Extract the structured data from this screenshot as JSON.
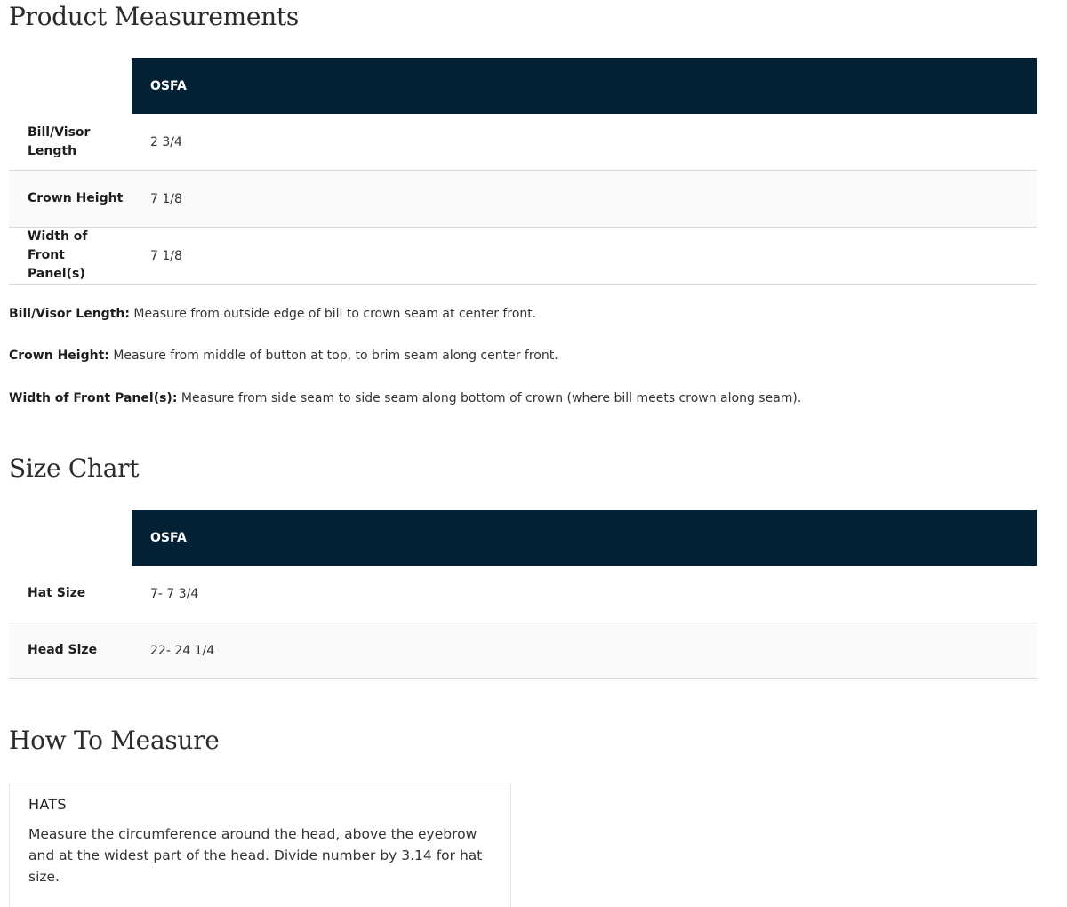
{
  "product_measurements": {
    "title": "Product Measurements",
    "column_header": "OSFA",
    "rows": [
      {
        "label": "Bill/Visor Length",
        "value": "2 3/4"
      },
      {
        "label": "Crown Height",
        "value": "7 1/8"
      },
      {
        "label": "Width of Front Panel(s)",
        "value": "7 1/8"
      }
    ],
    "notes": [
      {
        "term": "Bill/Visor Length:",
        "text": " Measure from outside edge of bill to crown seam at center front."
      },
      {
        "term": "Crown Height:",
        "text": " Measure from middle of button at top, to brim seam along center front."
      },
      {
        "term": "Width of Front Panel(s):",
        "text": " Measure from side seam to side seam along bottom of crown (where bill meets crown along seam)."
      }
    ]
  },
  "size_chart": {
    "title": "Size Chart",
    "column_header": "OSFA",
    "rows": [
      {
        "label": "Hat Size",
        "value": "7- 7 3/4"
      },
      {
        "label": "Head Size",
        "value": "22- 24 1/4"
      }
    ]
  },
  "how_to_measure": {
    "title": "How To Measure",
    "card": {
      "title": "HATS",
      "text": "Measure the circumference around the head, above the eyebrow and at the widest part of the head. Divide number by 3.14 for hat size."
    }
  },
  "colors": {
    "table_header_bg": "#022135",
    "table_header_text": "#ffffff",
    "row_divider": "#d8d8d8"
  }
}
